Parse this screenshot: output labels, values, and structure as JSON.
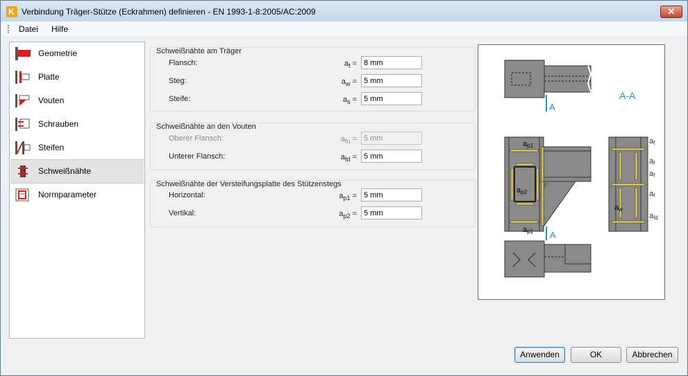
{
  "window": {
    "title": "Verbindung Träger-Stütze (Eckrahmen) definieren - EN 1993-1-8:2005/AC:2009",
    "close_glyph": "✕"
  },
  "menu": {
    "file": "Datei",
    "help": "Hilfe"
  },
  "sidebar": {
    "items": [
      {
        "label": "Geometrie",
        "icon": "geometry-icon"
      },
      {
        "label": "Platte",
        "icon": "plate-icon"
      },
      {
        "label": "Vouten",
        "icon": "haunch-icon"
      },
      {
        "label": "Schrauben",
        "icon": "bolts-icon"
      },
      {
        "label": "Steifen",
        "icon": "stiffeners-icon"
      },
      {
        "label": "Schweißnähte",
        "icon": "welds-icon",
        "selected": true
      },
      {
        "label": "Normparameter",
        "icon": "code-parameters-icon"
      }
    ]
  },
  "beam_welds": {
    "title": "Schweißnähte am Träger",
    "rows": [
      {
        "label": "Flansch:",
        "sym": "a",
        "sub": "f",
        "eq": " =",
        "value": "8 mm"
      },
      {
        "label": "Steg:",
        "sym": "a",
        "sub": "w",
        "eq": " =",
        "value": "5 mm"
      },
      {
        "label": "Steife:",
        "sym": "a",
        "sub": "s",
        "eq": " =",
        "value": "5 mm"
      }
    ]
  },
  "haunch_welds": {
    "title": "Schweißnähte an den Vouten",
    "rows": [
      {
        "label": "Oberer Flansch:",
        "sym": "a",
        "sub": "fu",
        "eq": " =",
        "value": "5 mm",
        "disabled": true
      },
      {
        "label": "Unterer Flansch:",
        "sym": "a",
        "sub": "fd",
        "eq": " =",
        "value": "5 mm"
      }
    ]
  },
  "web_plate_welds": {
    "title": "Schweißnähte der Versteifungsplatte des Stützenstegs",
    "rows": [
      {
        "label": "Horizontal:",
        "sym": "a",
        "sub": "p1",
        "eq": " =",
        "value": "5 mm"
      },
      {
        "label": "Vertikal:",
        "sym": "a",
        "sub": "p2",
        "eq": " =",
        "value": "5 mm"
      }
    ]
  },
  "diagram": {
    "section_top": "A",
    "section_bottom": "A",
    "section_title": "A-A",
    "labels": {
      "ap1_top": "p1",
      "ap2": "p2",
      "ap1_bottom": "p1",
      "aw": "w"
    },
    "right_labels": [
      {
        "s": "a",
        "sub": "f"
      },
      {
        "s": "a",
        "sub": "f"
      },
      {
        "s": "a",
        "sub": "f"
      },
      {
        "s": "a",
        "sub": "f"
      },
      {
        "s": "a",
        "sub": "fd"
      }
    ],
    "sym_a": "a"
  },
  "buttons": {
    "apply": "Anwenden",
    "ok": "OK",
    "cancel": "Abbrechen"
  },
  "colors": {
    "steel": "#787878",
    "weld": "#e6d25a",
    "accent": "#1f8fd6",
    "selected": "#e3e3e3"
  }
}
